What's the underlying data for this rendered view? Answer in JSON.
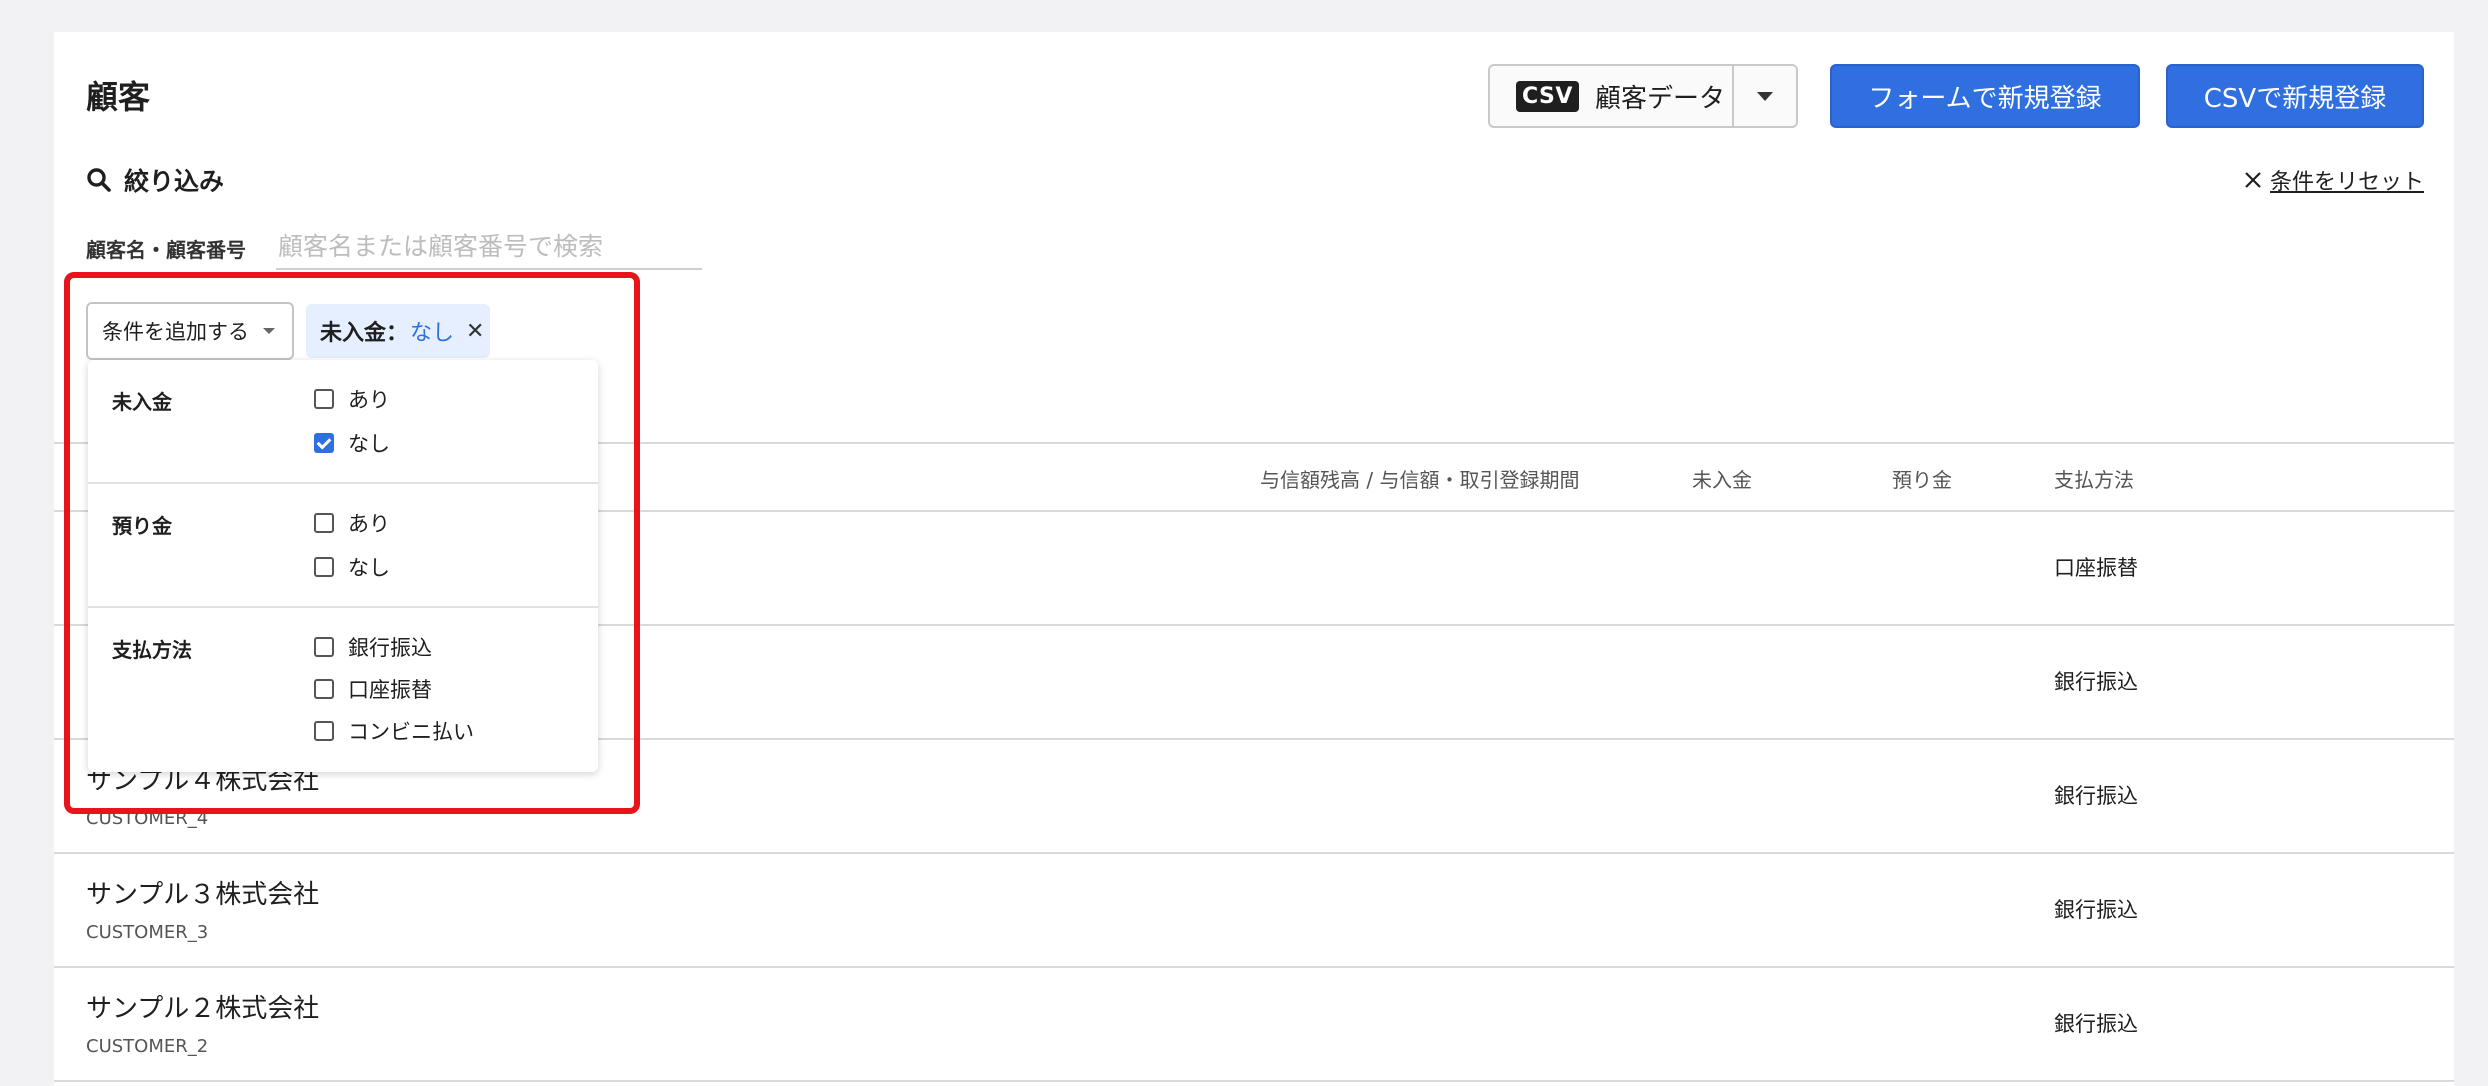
{
  "page": {
    "title": "顧客"
  },
  "toolbar": {
    "csv_badge": "CSV",
    "csv_label": "顧客データ",
    "form_register": "フォームで新規登録",
    "csv_register": "CSVで新規登録"
  },
  "filter": {
    "heading": "絞り込み",
    "reset": "条件をリセット",
    "search_label": "顧客名・顧客番号",
    "search_placeholder": "顧客名または顧客番号で検索",
    "add_condition": "条件を追加する",
    "chip": {
      "key": "未入金：",
      "value": "なし"
    }
  },
  "dropdown": {
    "sections": [
      {
        "label": "未入金",
        "options": [
          {
            "label": "あり",
            "checked": false
          },
          {
            "label": "なし",
            "checked": true
          }
        ]
      },
      {
        "label": "預り金",
        "options": [
          {
            "label": "あり",
            "checked": false
          },
          {
            "label": "なし",
            "checked": false
          }
        ]
      },
      {
        "label": "支払方法",
        "options": [
          {
            "label": "銀行振込",
            "checked": false
          },
          {
            "label": "口座振替",
            "checked": false
          },
          {
            "label": "コンビニ払い",
            "checked": false
          }
        ]
      }
    ]
  },
  "table": {
    "headers": [
      "与信額残高 / 与信額・取引登録期間",
      "未入金",
      "預り金",
      "支払方法"
    ],
    "rows": [
      {
        "name": "",
        "code": "",
        "payment": "口座振替"
      },
      {
        "name": "",
        "code": "",
        "payment": "銀行振込"
      },
      {
        "name": "サンプル４株式会社",
        "code": "CUSTOMER_4",
        "payment": "銀行振込"
      },
      {
        "name": "サンプル３株式会社",
        "code": "CUSTOMER_3",
        "payment": "銀行振込"
      },
      {
        "name": "サンプル２株式会社",
        "code": "CUSTOMER_2",
        "payment": "銀行振込"
      }
    ]
  },
  "colors": {
    "primary": "#2f6fe0",
    "highlight": "#e8141c",
    "chip_bg": "#e5efff"
  }
}
